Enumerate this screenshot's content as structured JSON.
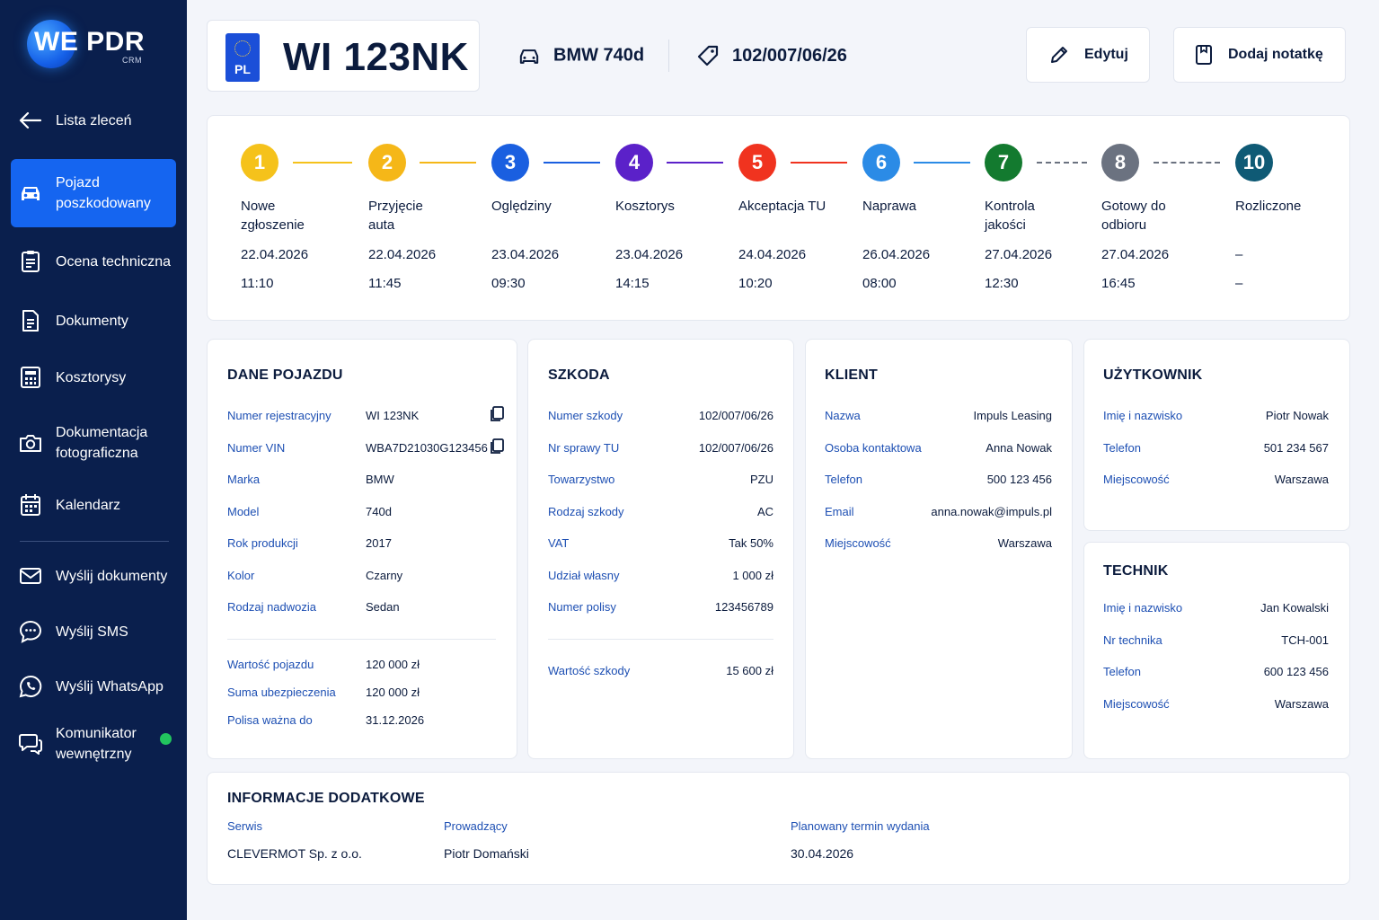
{
  "brand": {
    "logo": "WE PDR",
    "sub": "CRM"
  },
  "sidebar": {
    "back": "Lista zleceń",
    "items": [
      {
        "label": "Pojazd poszkodowany",
        "icon": "car-icon"
      },
      {
        "label": "Ocena techniczna",
        "icon": "clipboard-icon"
      },
      {
        "label": "Dokumenty",
        "icon": "document-icon"
      },
      {
        "label": "Kosztorysy",
        "icon": "calculator-icon"
      },
      {
        "label": "Dokumentacja fotograficzna",
        "icon": "camera-icon"
      },
      {
        "label": "Kalendarz",
        "icon": "calendar-icon"
      },
      {
        "label": "Wyślij dokumenty",
        "icon": "mail-icon"
      },
      {
        "label": "Wyślij SMS",
        "icon": "sms-icon"
      },
      {
        "label": "Wyślij WhatsApp",
        "icon": "whatsapp-icon"
      },
      {
        "label": "Komunikator wewnętrzny",
        "icon": "chat-icon"
      }
    ]
  },
  "header": {
    "country": "PL",
    "plate": "WI 123NK",
    "car": "BMW 740d",
    "claim": "102/007/06/26",
    "edit_label": "Edytuj",
    "note_label": "Dodaj notatkę"
  },
  "colors": {
    "s1": "#f5c21b",
    "s2": "#f5b718",
    "s3": "#1a5fe0",
    "s4": "#5b21c9",
    "s5": "#f0331f",
    "s6": "#2b8be6",
    "s7": "#137a2f",
    "s8": "#6b7280",
    "s10": "#0f5a75"
  },
  "timeline": [
    {
      "num": "1",
      "label": "Nowe zgłoszenie",
      "date": "22.04.2026",
      "time": "11:10"
    },
    {
      "num": "2",
      "label": "Przyjęcie auta",
      "date": "22.04.2026",
      "time": "11:45"
    },
    {
      "num": "3",
      "label": "Oględziny",
      "date": "23.04.2026",
      "time": "09:30"
    },
    {
      "num": "4",
      "label": "Kosztorys",
      "date": "23.04.2026",
      "time": "14:15"
    },
    {
      "num": "5",
      "label": "Akceptacja TU",
      "date": "24.04.2026",
      "time": "10:20"
    },
    {
      "num": "6",
      "label": "Naprawa",
      "date": "26.04.2026",
      "time": "08:00"
    },
    {
      "num": "7",
      "label": "Kontrola jakości",
      "date": "27.04.2026",
      "time": "12:30"
    },
    {
      "num": "8",
      "label": "Gotowy do odbioru",
      "date": "27.04.2026",
      "time": "16:45"
    },
    {
      "num": "10",
      "label": "Rozliczone",
      "date": "–",
      "time": "–"
    }
  ],
  "vehicle": {
    "title": "DANE POJAZDU",
    "rows": [
      {
        "label": "Numer rejestracyjny",
        "value": "WI 123NK"
      },
      {
        "label": "Numer VIN",
        "value": "WBA7D21030G123456"
      },
      {
        "label": "Marka",
        "value": "BMW"
      },
      {
        "label": "Model",
        "value": "740d"
      },
      {
        "label": "Rok produkcji",
        "value": "2017"
      },
      {
        "label": "Kolor",
        "value": "Czarny"
      },
      {
        "label": "Rodzaj nadwozia",
        "value": "Sedan"
      }
    ],
    "extra": [
      {
        "label": "Wartość pojazdu",
        "value": "120 000 zł"
      },
      {
        "label": "Suma ubezpieczenia",
        "value": "120 000 zł"
      },
      {
        "label": "Polisa ważna do",
        "value": "31.12.2026"
      }
    ]
  },
  "damage": {
    "title": "SZKODA",
    "rows": [
      {
        "label": "Numer szkody",
        "value": "102/007/06/26"
      },
      {
        "label": "Nr sprawy TU",
        "value": "102/007/06/26"
      },
      {
        "label": "Towarzystwo",
        "value": "PZU"
      },
      {
        "label": "Rodzaj szkody",
        "value": "AC"
      },
      {
        "label": "VAT",
        "value": "Tak 50%"
      },
      {
        "label": "Udział własny",
        "value": "1 000 zł"
      },
      {
        "label": "Numer polisy",
        "value": "123456789"
      }
    ],
    "total": {
      "label": "Wartość szkody",
      "value": "15 600 zł"
    }
  },
  "client": {
    "title": "KLIENT",
    "rows": [
      {
        "label": "Nazwa",
        "value": "Impuls Leasing"
      },
      {
        "label": "Osoba kontaktowa",
        "value": "Anna Nowak"
      },
      {
        "label": "Telefon",
        "value": "500 123 456"
      },
      {
        "label": "Email",
        "value": "anna.nowak@impuls.pl"
      },
      {
        "label": "Miejscowość",
        "value": "Warszawa"
      }
    ]
  },
  "user": {
    "title": "UŻYTKOWNIK",
    "rows": [
      {
        "label": "Imię i nazwisko",
        "value": "Piotr Nowak"
      },
      {
        "label": "Telefon",
        "value": "501 234 567"
      },
      {
        "label": "Miejscowość",
        "value": "Warszawa"
      }
    ]
  },
  "technician": {
    "title": "TECHNIK",
    "rows": [
      {
        "label": "Imię i nazwisko",
        "value": "Jan Kowalski"
      },
      {
        "label": "Nr technika",
        "value": "TCH-001"
      },
      {
        "label": "Telefon",
        "value": "600 123 456"
      },
      {
        "label": "Miejscowość",
        "value": "Warszawa"
      }
    ]
  },
  "additional": {
    "title": "INFORMACJE DODATKOWE",
    "service_label": "Serwis",
    "service": "CLEVERMOT Sp. z o.o.",
    "lead_label": "Prowadzący",
    "lead": "Piotr Domański",
    "planned_label": "Planowany termin wydania",
    "planned": "30.04.2026"
  }
}
